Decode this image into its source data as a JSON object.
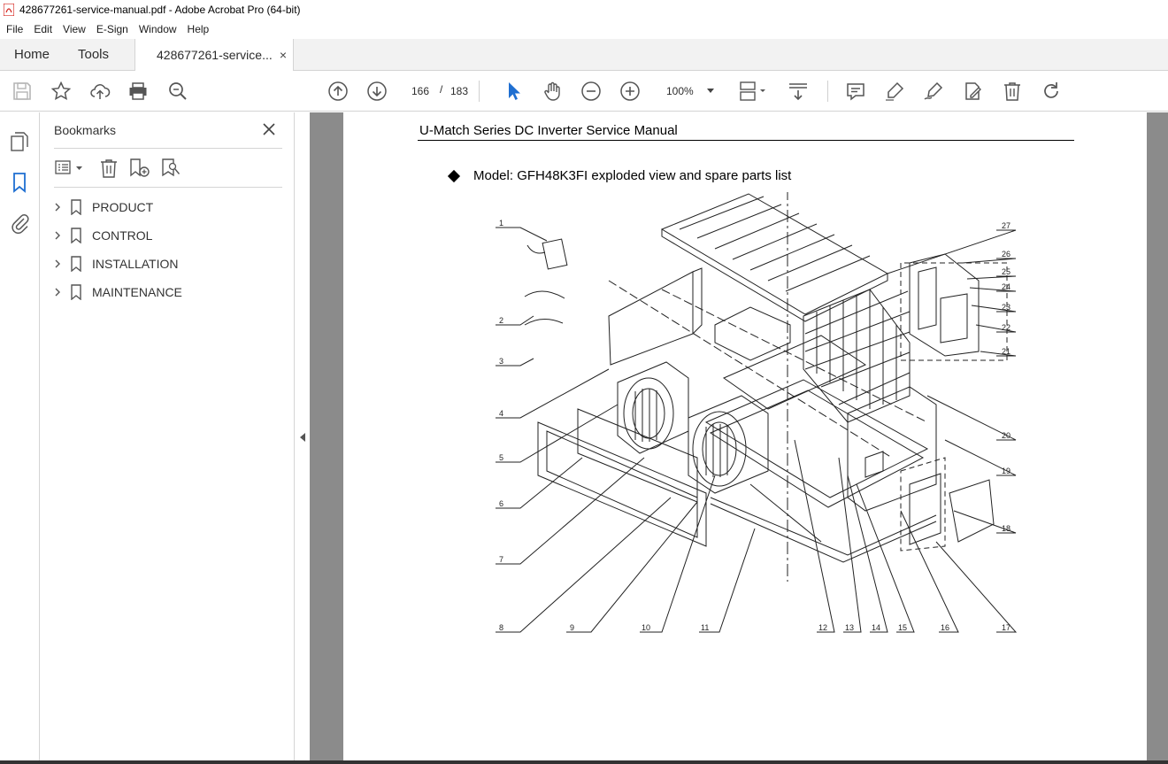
{
  "window": {
    "title": "428677261-service-manual.pdf - Adobe Acrobat Pro (64-bit)"
  },
  "menu": [
    "File",
    "Edit",
    "View",
    "E-Sign",
    "Window",
    "Help"
  ],
  "tabs": {
    "home": "Home",
    "tools": "Tools",
    "document": "428677261-service...",
    "close": "×"
  },
  "toolbar": {
    "page_current": "166",
    "page_sep": "/",
    "page_total": "183",
    "zoom": "100%"
  },
  "bookmarks": {
    "title": "Bookmarks",
    "items": [
      "PRODUCT",
      "CONTROL",
      "INSTALLATION",
      "MAINTENANCE"
    ]
  },
  "document": {
    "header": "U-Match Series DC Inverter Service Manual",
    "model_line": "Model: GFH48K3FI exploded view and spare parts list",
    "callouts": [
      "1",
      "2",
      "3",
      "4",
      "5",
      "6",
      "7",
      "8",
      "9",
      "10",
      "11",
      "12",
      "13",
      "14",
      "15",
      "16",
      "17",
      "18",
      "19",
      "20",
      "21",
      "22",
      "23",
      "24",
      "25",
      "26",
      "27"
    ]
  },
  "colors": {
    "acrobat_red": "#d4221b",
    "panel_border": "#d4d4d4",
    "doc_bg": "#8b8b8b",
    "icon_gray": "#555555"
  }
}
